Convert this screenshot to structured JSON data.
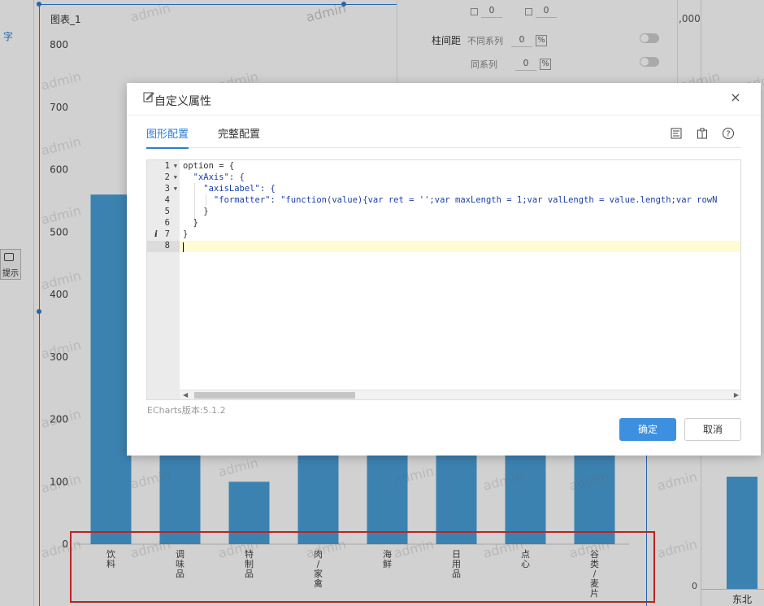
{
  "background": {
    "left_panel": {
      "label_zi": "字",
      "hint_label": "提示"
    },
    "chart_title": "图表_1",
    "top_props": {
      "gap_label": "柱间距",
      "diff_series_label": "不同系列",
      "same_series_label": "同系列",
      "val_a": "0",
      "val_b": "0",
      "diff_value": "0",
      "same_value": "0",
      "pct": "%"
    },
    "right_chart": {
      "top_tick": ",000",
      "zero_tick": "0",
      "category": "东北"
    },
    "watermark": "admin"
  },
  "chart_data": {
    "type": "bar",
    "categories": [
      "饮料",
      "调味品",
      "特制品",
      "肉/家禽",
      "海鲜",
      "日用品",
      "点心",
      "谷类/麦片"
    ],
    "category_labels_vertical": [
      "饮\n料",
      "调\n味\n品",
      "特\n制\n品",
      "肉\n/\n家\n禽",
      "海\n鲜",
      "日\n用\n品",
      "点\n心",
      "谷\n类\n/\n麦\n片"
    ],
    "values": [
      560,
      null,
      100,
      null,
      null,
      null,
      null,
      null
    ],
    "y_ticks": [
      "0",
      "100",
      "200",
      "300",
      "400",
      "500",
      "600",
      "700",
      "800"
    ],
    "ylim": [
      0,
      800
    ],
    "color": "#4a9fd8",
    "title": ""
  },
  "dialog": {
    "title": "自定义属性",
    "close": "×",
    "tabs": [
      {
        "label": "图形配置",
        "active": true
      },
      {
        "label": "完整配置",
        "active": false
      }
    ],
    "editor": {
      "line_numbers": [
        "1",
        "2",
        "3",
        "4",
        "5",
        "6",
        "7",
        "8"
      ],
      "lines": [
        "option = {",
        "  \"xAxis\": {",
        "    \"axisLabel\": {",
        "      \"formatter\": \"function(value){var ret = '';var maxLength = 1;var valLength = value.length;var rowN",
        "    }",
        "  }",
        "}",
        ""
      ]
    },
    "version": "ECharts版本:5.1.2",
    "ok_label": "确定",
    "cancel_label": "取消"
  }
}
